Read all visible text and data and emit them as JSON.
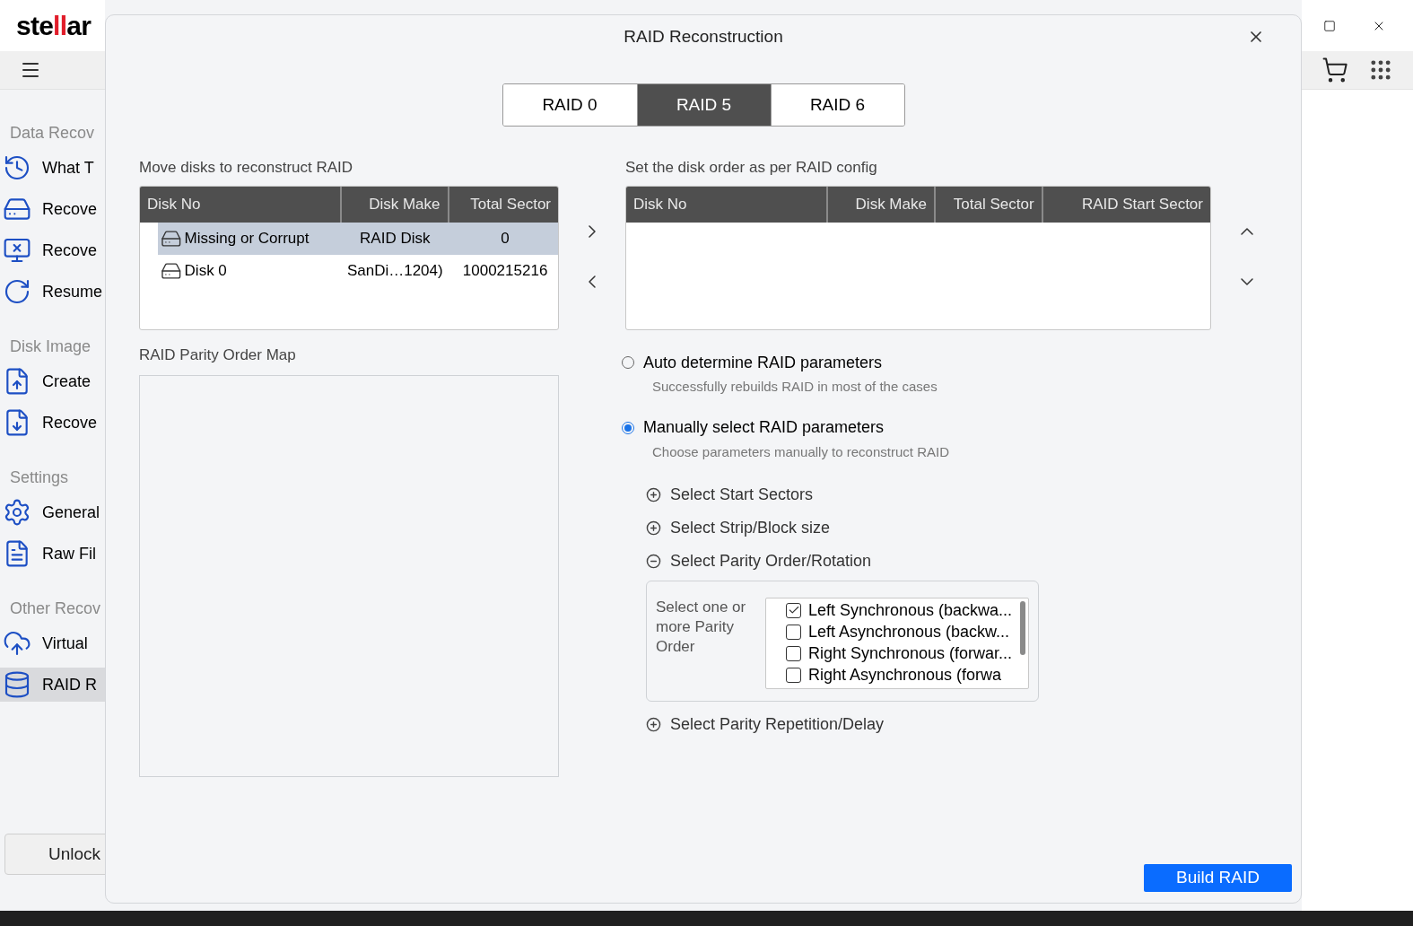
{
  "app": {
    "logo": {
      "start": "ste",
      "mark": "ll",
      "end": "ar"
    },
    "sidebar": [
      {
        "title": "Data Recov",
        "items": [
          {
            "label": "What T",
            "selected": false
          },
          {
            "label": "Recove",
            "selected": false
          },
          {
            "label": "Recove",
            "selected": false
          },
          {
            "label": "Resume",
            "selected": false
          }
        ]
      },
      {
        "title": "Disk Image",
        "items": [
          {
            "label": "Create",
            "selected": false
          },
          {
            "label": "Recove",
            "selected": false
          }
        ]
      },
      {
        "title": "Settings",
        "items": [
          {
            "label": "General",
            "selected": false
          },
          {
            "label": "Raw Fil",
            "selected": false
          }
        ]
      },
      {
        "title": "Other Recov",
        "items": [
          {
            "label": "Virtual",
            "selected": false
          },
          {
            "label": "RAID R",
            "selected": true
          }
        ]
      }
    ],
    "unlock_button": "Unlock"
  },
  "dialog": {
    "title": "RAID Reconstruction",
    "tabs": [
      {
        "label": "RAID 0",
        "selected": false
      },
      {
        "label": "RAID 5",
        "selected": true
      },
      {
        "label": "RAID 6",
        "selected": false
      }
    ],
    "source": {
      "label": "Move disks to reconstruct RAID",
      "columns": [
        "Disk No",
        "Disk Make",
        "Total Sector"
      ],
      "rows": [
        {
          "cells": [
            "Missing or Corrupt",
            "RAID Disk",
            "0"
          ],
          "selected": true
        },
        {
          "cells": [
            "Disk 0",
            "SanDi…1204)",
            "1000215216"
          ],
          "selected": false
        }
      ]
    },
    "parity_map": {
      "label": "RAID Parity Order Map"
    },
    "target": {
      "label": "Set the disk order as per RAID config",
      "columns": [
        "Disk No",
        "Disk Make",
        "Total Sector",
        "RAID Start Sector"
      ]
    },
    "modes": [
      {
        "label": "Auto determine RAID parameters",
        "description": "Successfully rebuilds RAID in most of the cases",
        "selected": false
      },
      {
        "label": "Manually select RAID parameters",
        "description": "Choose parameters manually to reconstruct RAID",
        "selected": true
      }
    ],
    "options": [
      {
        "label": "Select Start Sectors",
        "expanded": false
      },
      {
        "label": "Select Strip/Block size",
        "expanded": false
      },
      {
        "label": "Select Parity Order/Rotation",
        "expanded": true
      },
      {
        "label": "Select Parity Repetition/Delay",
        "expanded": false
      }
    ],
    "parity_orders": {
      "label": "Select one or more Parity Order",
      "items": [
        {
          "label": "Left Synchronous (backwa...",
          "checked": true
        },
        {
          "label": "Left Asynchronous (backw...",
          "checked": false
        },
        {
          "label": "Right Synchronous (forwar...",
          "checked": false
        },
        {
          "label": "Right Asynchronous (forwa",
          "checked": false
        }
      ]
    },
    "build_button": "Build RAID"
  }
}
